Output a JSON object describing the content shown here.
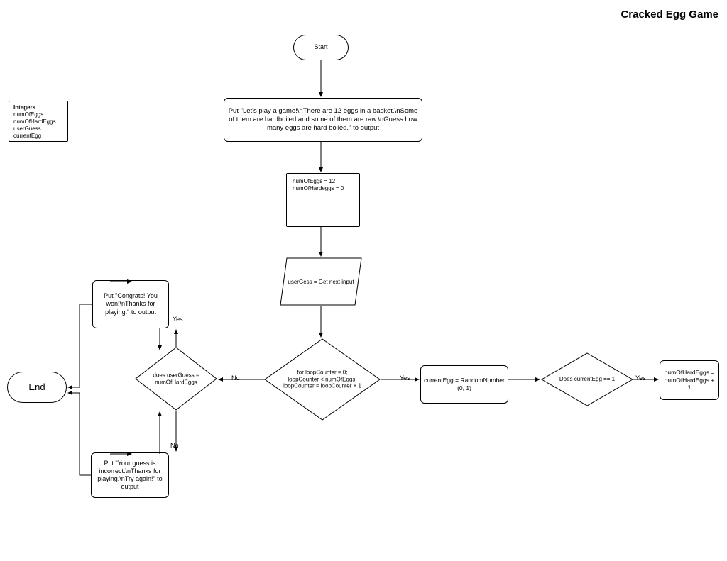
{
  "title": "Cracked Egg Game",
  "vars": {
    "header": "Integers",
    "l1": "numOfEggs",
    "l2": "numOfHardEggs",
    "l3": "userGuess",
    "l4": "currentEgg"
  },
  "start": "Start",
  "end": "End",
  "intro": "Put \"Let's play a game!\\nThere are 12 eggs in a basket.\\nSome of them are hardboiled and some of them are raw.\\nGuess how many eggs are hard boiled.\" to output",
  "assign": {
    "l1": "numOfEggs = 12",
    "l2": "numOfHardeggs = 0"
  },
  "input": "userGess = Get next input",
  "loop": "for loopCounter = 0; loopCounter < numOfEggs; loopCounter = loopCounter + 1",
  "guessCheck": "does userGuess = numOfHardEggs",
  "congrats": "Put \"Congrats! You won!\\nThanks for playing.\" to output",
  "incorrect": "Put \"Your guess is incorrect.\\nThanks for playing.\\nTry again!\" to output",
  "random": "currentEgg = RandomNumber (0, 1)",
  "eggCheck": "Does currentEgg == 1",
  "increment": "numOfHardEggs = numOfHardEggs + 1",
  "labels": {
    "yes": "Yes",
    "no": "No"
  }
}
